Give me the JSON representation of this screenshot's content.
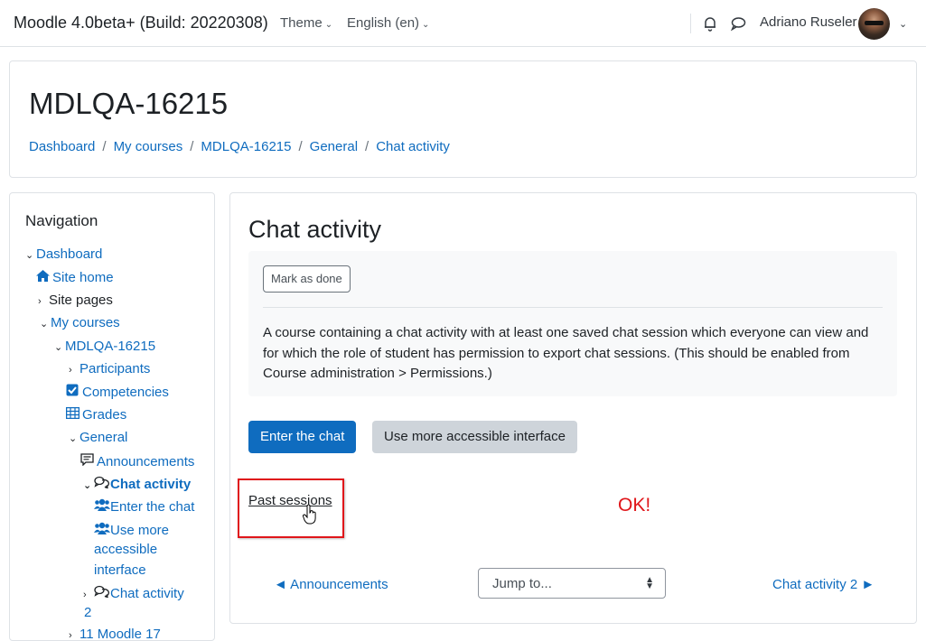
{
  "topbar": {
    "brand": "Moodle 4.0beta+ (Build: 20220308)",
    "theme_menu": "Theme",
    "language_menu": "English (en)",
    "user_name": "Adriano Ruseler",
    "icons": [
      "bell-icon",
      "chat-bubble-icon",
      "chevron-down-icon"
    ]
  },
  "header": {
    "course_title": "MDLQA-16215",
    "breadcrumb": [
      "Dashboard",
      "My courses",
      "MDLQA-16215",
      "General",
      "Chat activity"
    ]
  },
  "navigation": {
    "title": "Navigation",
    "items": [
      {
        "label": "Dashboard",
        "caret": "down",
        "icon": ""
      },
      {
        "label": "Site home",
        "caret": "",
        "icon": "home-icon"
      },
      {
        "label": "Site pages",
        "caret": "right",
        "icon": ""
      },
      {
        "label": "My courses",
        "caret": "down",
        "icon": ""
      },
      {
        "label": "MDLQA-16215",
        "caret": "down",
        "icon": ""
      },
      {
        "label": "Participants",
        "caret": "right",
        "icon": ""
      },
      {
        "label": "Competencies",
        "caret": "",
        "icon": "checkbox-icon"
      },
      {
        "label": "Grades",
        "caret": "",
        "icon": "table-icon"
      },
      {
        "label": "General",
        "caret": "down",
        "icon": ""
      },
      {
        "label": "Announcements",
        "caret": "",
        "icon": "forum-icon"
      },
      {
        "label": "Chat activity",
        "caret": "down",
        "icon": "chat-icon"
      },
      {
        "label": "Enter the chat",
        "caret": "",
        "icon": "users-icon"
      },
      {
        "label": "Use more",
        "caret": "",
        "icon": "users-icon"
      },
      {
        "label": "accessible",
        "caret": "",
        "icon": ""
      },
      {
        "label": "interface",
        "caret": "",
        "icon": ""
      },
      {
        "label": "Chat activity",
        "caret": "right",
        "icon": "chat-icon"
      },
      {
        "label": "2",
        "caret": "",
        "icon": ""
      },
      {
        "label": "11 Moodle 17",
        "caret": "right",
        "icon": ""
      }
    ]
  },
  "main": {
    "title": "Chat activity",
    "mark_done": "Mark as done",
    "intro": "A course containing a chat activity with at least one saved chat session which everyone can view and for which the role of student has permission to export chat sessions. (This should be enabled from Course administration > Permissions.)",
    "enter_chat": "Enter the chat",
    "accessible": "Use more accessible interface",
    "past_sessions": "Past sessions",
    "annotation_ok": "OK!",
    "prev_activity": "◄ Announcements",
    "jump_to": "Jump to...",
    "next_activity": "Chat activity 2 ►",
    "annotation_color": "#e0161a",
    "accent_color": "#0f6cbf"
  }
}
